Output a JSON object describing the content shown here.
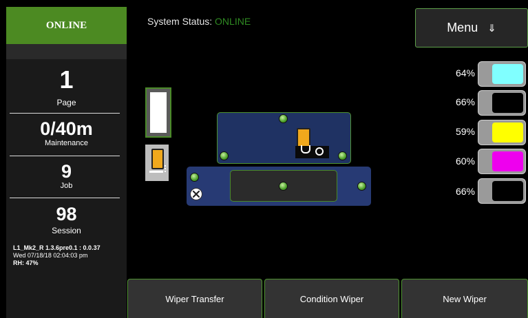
{
  "sidebar": {
    "status": "ONLINE",
    "stats": [
      {
        "value": "1",
        "label": "Page"
      },
      {
        "value": "0/40m",
        "label": "Maintenance"
      },
      {
        "value": "9",
        "label": "Job"
      },
      {
        "value": "98",
        "label": "Session"
      }
    ],
    "version": "L1_Mk2_R 1.3.6pre0.1 : 0.0.37",
    "datetime": "Wed 07/18/18 02:04:03 pm",
    "humidity": "RH: 47%"
  },
  "header": {
    "system_status_label": "System Status:",
    "system_status_value": "ONLINE",
    "menu_label": "Menu",
    "menu_arrow": "⇓"
  },
  "ink": [
    {
      "percent": "64%",
      "color": "#80ffff",
      "name": "cyan"
    },
    {
      "percent": "66%",
      "color": "#000000",
      "name": "black"
    },
    {
      "percent": "59%",
      "color": "#ffff00",
      "name": "yellow"
    },
    {
      "percent": "60%",
      "color": "#ee00ee",
      "name": "magenta"
    },
    {
      "percent": "66%",
      "color": "#000000",
      "name": "black"
    }
  ],
  "buttons": {
    "wiper_transfer": "Wiper Transfer",
    "condition_wiper": "Condition Wiper",
    "new_wiper": "New Wiper"
  },
  "colors": {
    "accent_green": "#4c8a22",
    "online_text": "#2f8a22",
    "panel_blue": "#1f3263"
  }
}
